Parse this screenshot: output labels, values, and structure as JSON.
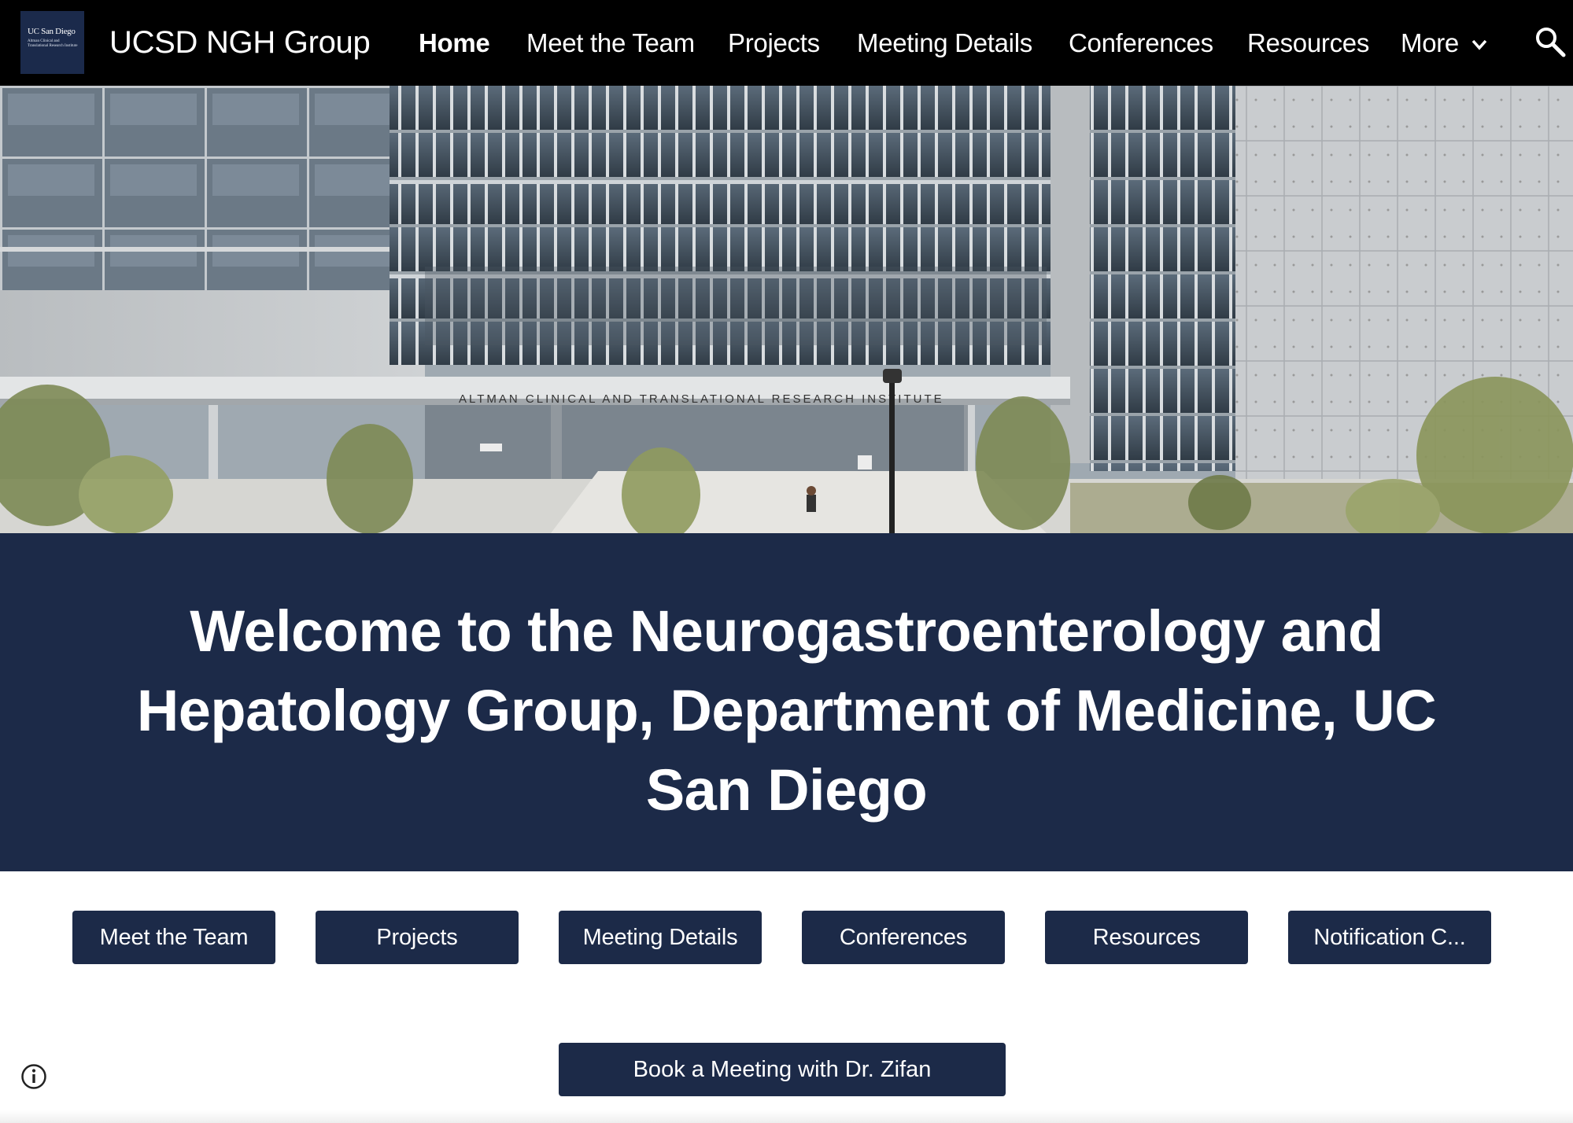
{
  "header": {
    "logo_text": "UC San Diego",
    "logo_subtext": "Altman Clinical and Translational Research Institute",
    "site_title": "UCSD NGH Group",
    "nav": [
      {
        "label": "Home",
        "active": true
      },
      {
        "label": "Meet the Team"
      },
      {
        "label": "Projects"
      },
      {
        "label": "Meeting Details"
      },
      {
        "label": "Conferences"
      },
      {
        "label": "Resources"
      },
      {
        "label": "More"
      }
    ],
    "icons": {
      "more": "chevron-down-icon",
      "search": "search-icon"
    }
  },
  "hero": {
    "building_sign": "ALTMAN CLINICAL AND TRANSLATIONAL RESEARCH INSTITUTE"
  },
  "welcome": {
    "heading": "Welcome to the Neurogastroenterology and Hepatology Group, Department of Medicine, UC San Diego"
  },
  "buttons": [
    {
      "label": "Meet the Team"
    },
    {
      "label": "Projects"
    },
    {
      "label": "Meeting Details"
    },
    {
      "label": "Conferences"
    },
    {
      "label": "Resources"
    },
    {
      "label": "Notification C..."
    }
  ],
  "book_button": {
    "label": "Book a Meeting with Dr. Zifan"
  },
  "footer": {
    "info_icon": "info-icon"
  },
  "colors": {
    "topbar": "#000000",
    "band": "#1c2a48",
    "button": "#1c2a48",
    "text_on_dark": "#ffffff"
  }
}
